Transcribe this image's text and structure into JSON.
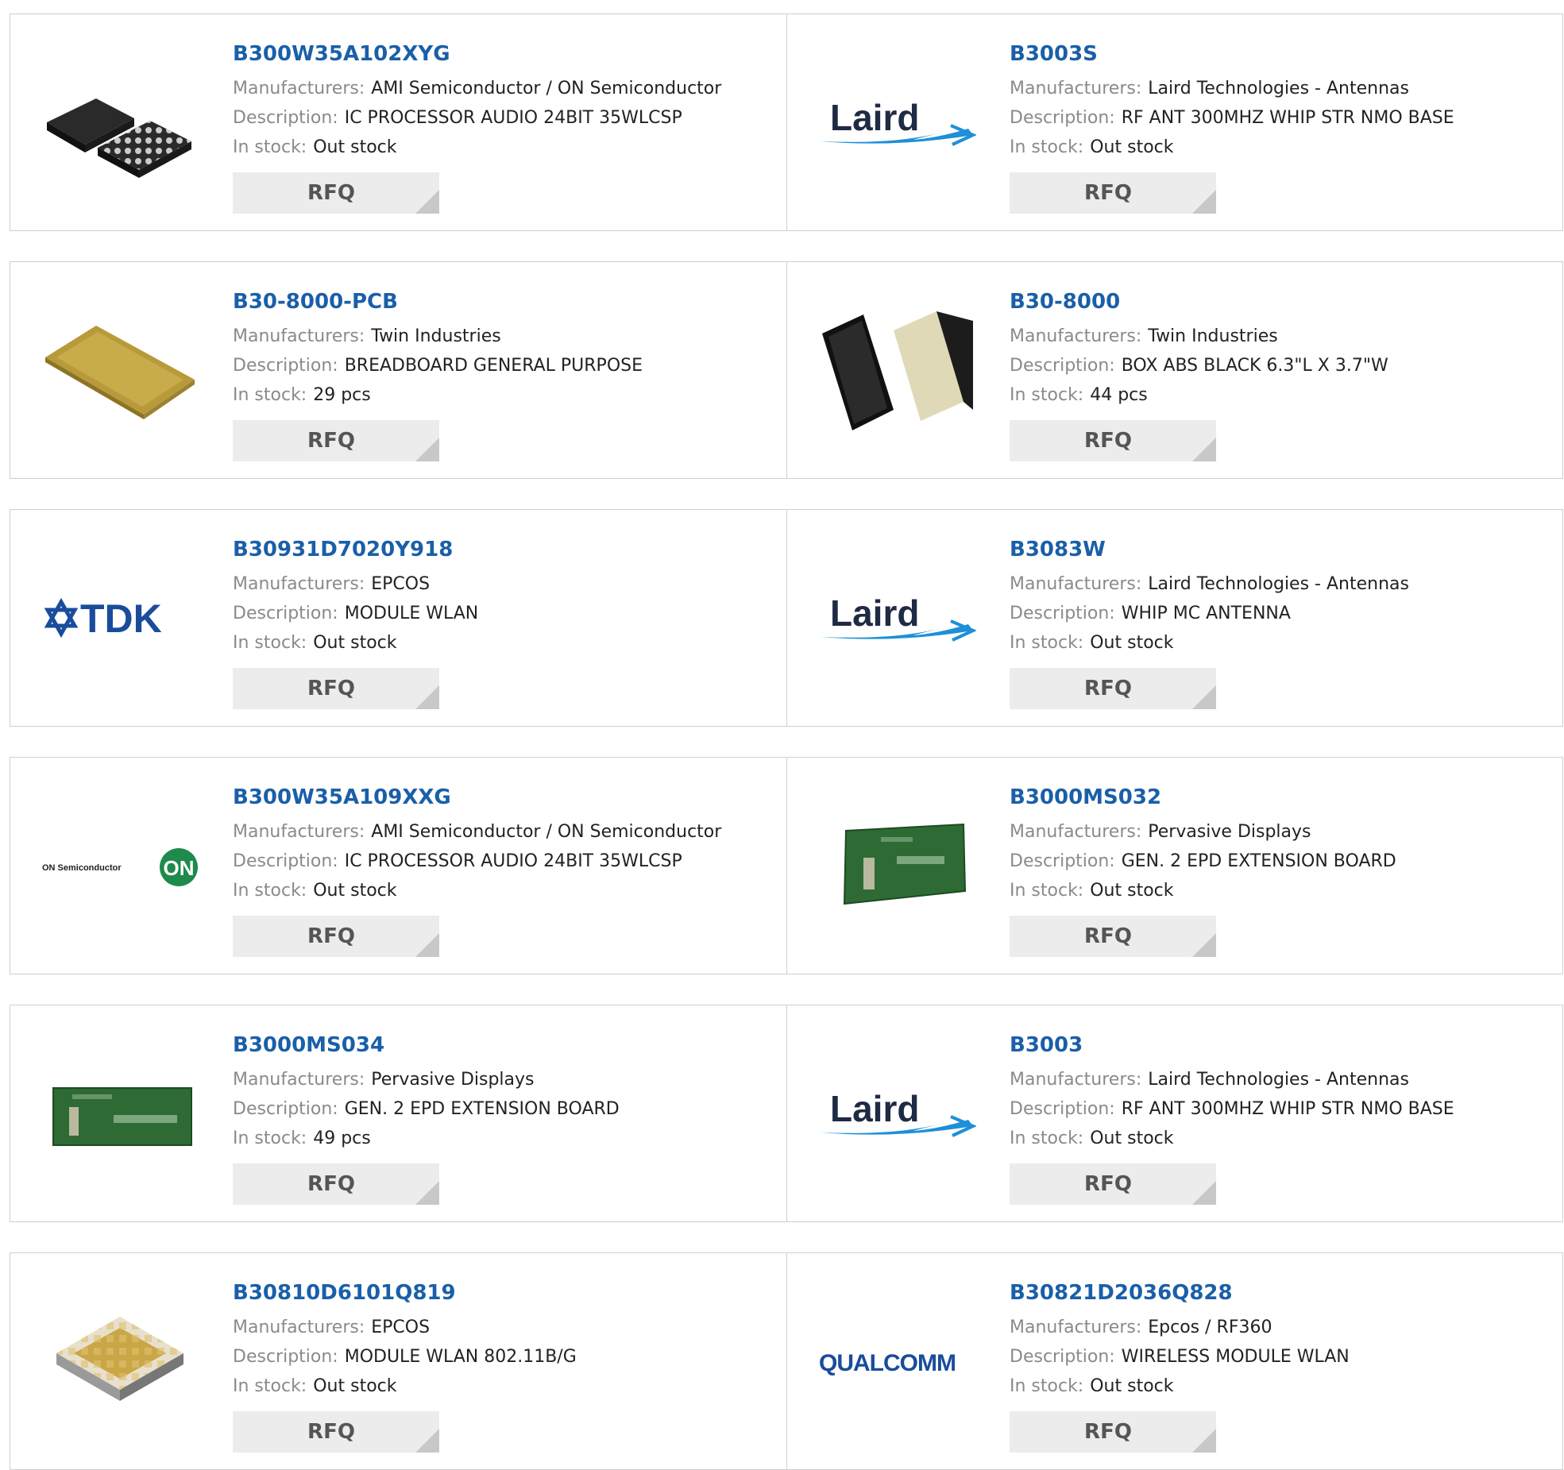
{
  "labels": {
    "manufacturer": "Manufacturers:",
    "description": "Description:",
    "stock": "In stock:",
    "rfq": "RFQ"
  },
  "logos": {
    "laird": "Laird",
    "tdk": "TDK",
    "onsemi": "ON Semiconductor",
    "on_badge": "ON",
    "qualcomm": "QUALCOMM"
  },
  "products": [
    {
      "part": "B300W35A102XYG",
      "manufacturer": "AMI Semiconductor / ON Semiconductor",
      "description": "IC PROCESSOR AUDIO 24BIT 35WLCSP",
      "stock": "Out stock",
      "image": "bga-chip"
    },
    {
      "part": "B3003S",
      "manufacturer": "Laird Technologies - Antennas",
      "description": "RF ANT 300MHZ WHIP STR NMO BASE",
      "stock": "Out stock",
      "image": "laird-logo"
    },
    {
      "part": "B30-8000-PCB",
      "manufacturer": "Twin Industries",
      "description": "BREADBOARD GENERAL PURPOSE",
      "stock": "29 pcs",
      "image": "breadboard"
    },
    {
      "part": "B30-8000",
      "manufacturer": "Twin Industries",
      "description": "BOX ABS BLACK 6.3\"L X 3.7\"W",
      "stock": "44 pcs",
      "image": "abs-box"
    },
    {
      "part": "B30931D7020Y918",
      "manufacturer": "EPCOS",
      "description": "MODULE WLAN",
      "stock": "Out stock",
      "image": "tdk-logo"
    },
    {
      "part": "B3083W",
      "manufacturer": "Laird Technologies - Antennas",
      "description": "WHIP MC ANTENNA",
      "stock": "Out stock",
      "image": "laird-logo"
    },
    {
      "part": "B300W35A109XXG",
      "manufacturer": "AMI Semiconductor / ON Semiconductor",
      "description": "IC PROCESSOR AUDIO 24BIT 35WLCSP",
      "stock": "Out stock",
      "image": "onsemi-logo"
    },
    {
      "part": "B3000MS032",
      "manufacturer": "Pervasive Displays",
      "description": "GEN. 2 EPD EXTENSION BOARD",
      "stock": "Out stock",
      "image": "green-board-angled"
    },
    {
      "part": "B3000MS034",
      "manufacturer": "Pervasive Displays",
      "description": "GEN. 2 EPD EXTENSION BOARD",
      "stock": "49 pcs",
      "image": "green-board"
    },
    {
      "part": "B3003",
      "manufacturer": "Laird Technologies - Antennas",
      "description": "RF ANT 300MHZ WHIP STR NMO BASE",
      "stock": "Out stock",
      "image": "laird-logo"
    },
    {
      "part": "B30810D6101Q819",
      "manufacturer": "EPCOS",
      "description": "MODULE WLAN 802.11B/G",
      "stock": "Out stock",
      "image": "wlan-module"
    },
    {
      "part": "B30821D2036Q828",
      "manufacturer": "Epcos / RF360",
      "description": "WIRELESS MODULE WLAN",
      "stock": "Out stock",
      "image": "qualcomm-logo"
    }
  ]
}
